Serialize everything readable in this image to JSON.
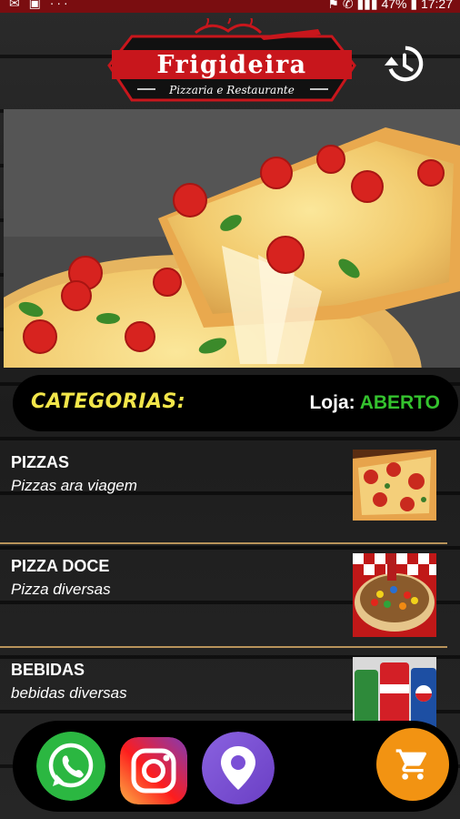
{
  "statusbar": {
    "left": "✉ ▣ ···",
    "right": "⚑ ✆ ▮▮▮ 47% ▮ 17:27"
  },
  "logo": {
    "name": "Frigideira",
    "tagline": "Pizzaria e Restaurante"
  },
  "header": {
    "history_icon": "history-icon"
  },
  "categories_header": {
    "title": "CATEGORIAS:",
    "store_label": "Loja:",
    "store_status": "ABERTO"
  },
  "categories": [
    {
      "name": "PIZZAS",
      "description": "Pizzas ara viagem"
    },
    {
      "name": "PIZZA DOCE",
      "description": "Pizza diversas"
    },
    {
      "name": "BEBIDAS",
      "description": "bebidas diversas"
    }
  ],
  "bottom_bar": {
    "icons": [
      "whatsapp-icon",
      "instagram-icon",
      "location-icon"
    ],
    "cart_icon": "cart-icon"
  },
  "colors": {
    "accent_yellow": "#f2e64a",
    "status_green": "#34c22e",
    "cart_orange": "#f29312",
    "divider": "#b8935a",
    "logo_red": "#c8161c"
  }
}
